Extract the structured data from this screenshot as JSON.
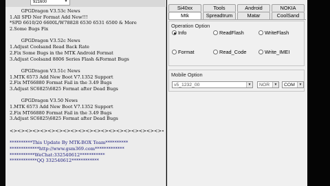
{
  "toolbar": {
    "top_field_value": "921600"
  },
  "log_lines": [
    {
      "text": "        GPGDragon V3.53c News",
      "color": "normal"
    },
    {
      "text": "1.All SPD Nor Format Add New!!!",
      "color": "normal"
    },
    {
      "text": "*SPD 6610/20 6600L/W78828 6530 6531 6500 & More",
      "color": "normal"
    },
    {
      "text": "2.Some Bugs Fix",
      "color": "normal"
    },
    {
      "text": "",
      "color": "normal"
    },
    {
      "text": "        GPGDragon V3.52c News",
      "color": "normal"
    },
    {
      "text": "1.Adjust Coolsand Read Back Rate",
      "color": "normal"
    },
    {
      "text": "2.Fix Some Bugs in the MTK Android Format",
      "color": "normal"
    },
    {
      "text": "3.Adjust Coolsand 8806 Series Flash &Format Bugs",
      "color": "normal"
    },
    {
      "text": "",
      "color": "normal"
    },
    {
      "text": "        GPGDragon V3.51c News",
      "color": "normal"
    },
    {
      "text": "1.MTK 6573 Add New Boot V7.1352 Support",
      "color": "normal"
    },
    {
      "text": "2.Fix MT66880 Format Fail in the 3.49 Bugs",
      "color": "normal"
    },
    {
      "text": "3.Adjust SC6825\\6825 Format after Dead Bugs",
      "color": "normal"
    },
    {
      "text": "",
      "color": "normal"
    },
    {
      "text": "        GPGDragon V3.50 News",
      "color": "normal"
    },
    {
      "text": "1.MTK 6573 Add New Boot V7.1352 Support",
      "color": "normal"
    },
    {
      "text": "2.Fix MT66880 Format Fail in the 3.49 Bugs",
      "color": "normal"
    },
    {
      "text": "3.Adjust SC6825\\6825 Format after Dead Bugs",
      "color": "normal"
    },
    {
      "text": "",
      "color": "normal"
    },
    {
      "text": "<><><><><><><><><><><><><><><><><><><><><><><><><><><><><>",
      "color": "normal"
    },
    {
      "text": "",
      "color": "normal"
    },
    {
      "text": "**********This Update By MTK-BOX Team**********",
      "color": "blue"
    },
    {
      "text": "*************http://www.gsm369.com*************",
      "color": "blue"
    },
    {
      "text": "***********WeChat:332540612***********",
      "color": "blue"
    },
    {
      "text": "************QQ 332540612************",
      "color": "blue"
    }
  ],
  "tabs_row1": [
    "Si40xx",
    "Tools",
    "Android",
    "NOKIA"
  ],
  "tabs_row2": [
    "Mtk",
    "Spreadtrum",
    "Matar",
    "CoolSand"
  ],
  "active_tab": "Mtk",
  "operation_option": {
    "title": "Operation Option",
    "options": [
      "Info",
      "ReadFlash",
      "WriteFlash",
      "Format",
      "Read_Code",
      "Write_IMEI"
    ],
    "selected": "Info"
  },
  "mobile_option": {
    "title": "Mobile Option",
    "model_value": "v5_1232_00",
    "flash_value": "NOR",
    "port_value": "COM"
  }
}
